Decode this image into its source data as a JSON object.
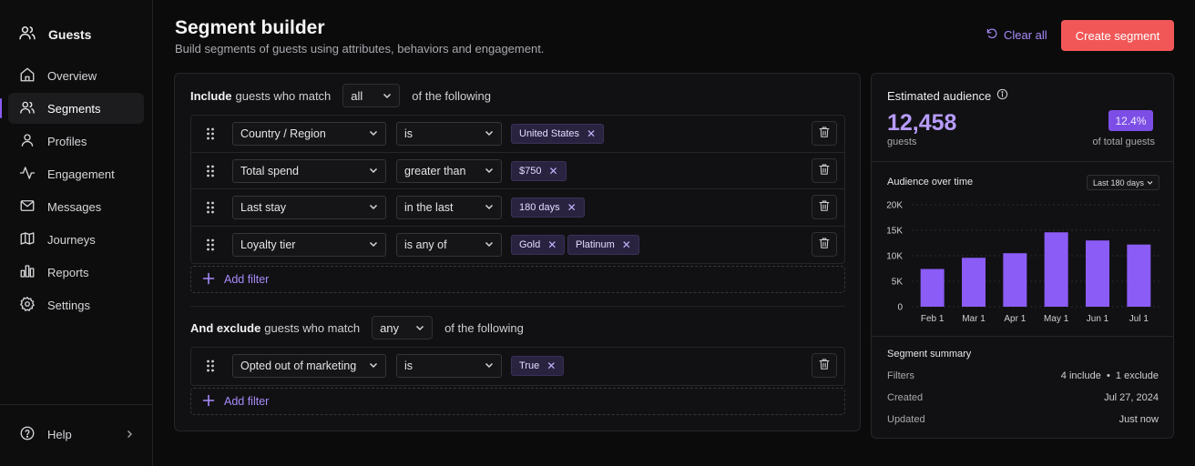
{
  "sidebar": {
    "brand": "Guests",
    "items": [
      {
        "label": "Overview",
        "icon": "home-icon"
      },
      {
        "label": "Segments",
        "icon": "users-icon",
        "active": true
      },
      {
        "label": "Profiles",
        "icon": "user-icon"
      },
      {
        "label": "Engagement",
        "icon": "activity-icon"
      },
      {
        "label": "Messages",
        "icon": "mail-icon"
      },
      {
        "label": "Journeys",
        "icon": "map-icon"
      },
      {
        "label": "Reports",
        "icon": "bar-chart-icon"
      },
      {
        "label": "Settings",
        "icon": "gear-icon"
      }
    ],
    "help": "Help"
  },
  "header": {
    "title": "Segment builder",
    "subtitle": "Build segments of guests using attributes, behaviors and engagement.",
    "clear_all": "Clear all",
    "create": "Create segment"
  },
  "include": {
    "lead": "Include",
    "mid": "guests who match",
    "mode": "all",
    "tail": "of the following",
    "filters": [
      {
        "field": "Country / Region",
        "op": "is",
        "values": [
          "United States"
        ]
      },
      {
        "field": "Total spend",
        "op": "greater than",
        "values": [
          "$750"
        ]
      },
      {
        "field": "Last stay",
        "op": "in the last",
        "values": [
          "180 days"
        ]
      },
      {
        "field": "Loyalty tier",
        "op": "is any of",
        "values": [
          "Gold",
          "Platinum"
        ]
      }
    ],
    "add_filter": "Add filter"
  },
  "exclude": {
    "lead": "And exclude",
    "mid": "guests who match",
    "mode": "any",
    "tail": "of the following",
    "filters": [
      {
        "field": "Opted out of marketing",
        "op": "is",
        "values": [
          "True"
        ]
      }
    ],
    "add_filter": "Add filter"
  },
  "estimate": {
    "title": "Estimated audience",
    "count": "12,458",
    "count_label": "guests",
    "percent": "12.4%",
    "percent_label": "of total guests",
    "chart_title": "Audience over time",
    "range": "Last 180 days"
  },
  "chart_data": {
    "type": "bar",
    "categories": [
      "Feb 1",
      "Mar 1",
      "Apr 1",
      "May 1",
      "Jun 1",
      "Jul 1"
    ],
    "values": [
      7400,
      9600,
      10500,
      14600,
      13000,
      12200
    ],
    "ylim": [
      0,
      20000
    ],
    "yticks": [
      "0",
      "5K",
      "10K",
      "15K",
      "20K"
    ],
    "grid": true,
    "bar_color": "#8b5cf6"
  },
  "summary": {
    "title": "Segment summary",
    "filters_label": "Filters",
    "filters_value_a": "4 include",
    "filters_value_b": "1 exclude",
    "created_label": "Created",
    "created_value": "Jul 27, 2024",
    "updated_label": "Updated",
    "updated_value": "Just now"
  },
  "colors": {
    "accent": "#8b5cf6",
    "primary_button": "#f25757"
  }
}
